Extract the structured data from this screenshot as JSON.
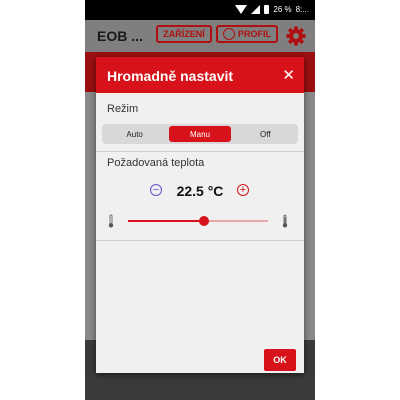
{
  "status_bar": {
    "battery": "26 %",
    "time": "8:..."
  },
  "app_header": {
    "title": "EOB ...",
    "devices_button": "ZAŘÍZENÍ",
    "profile_button": "PROFIL",
    "settings_icon": "gear-icon"
  },
  "dialog": {
    "title": "Hromadně nastavit",
    "close_glyph": "✕",
    "mode_label": "Režim",
    "modes": [
      "Auto",
      "Manu",
      "Off"
    ],
    "selected_mode": "Manu",
    "temperature_label": "Požadovaná teplota",
    "temperature_value": "22.5 °C",
    "minus_glyph": "−",
    "plus_glyph": "+",
    "slider_level": 0.54,
    "ok_label": "OK"
  },
  "colors": {
    "accent": "#d7121a",
    "minus": "#6a4fc8",
    "track": "#e6a9ab"
  }
}
